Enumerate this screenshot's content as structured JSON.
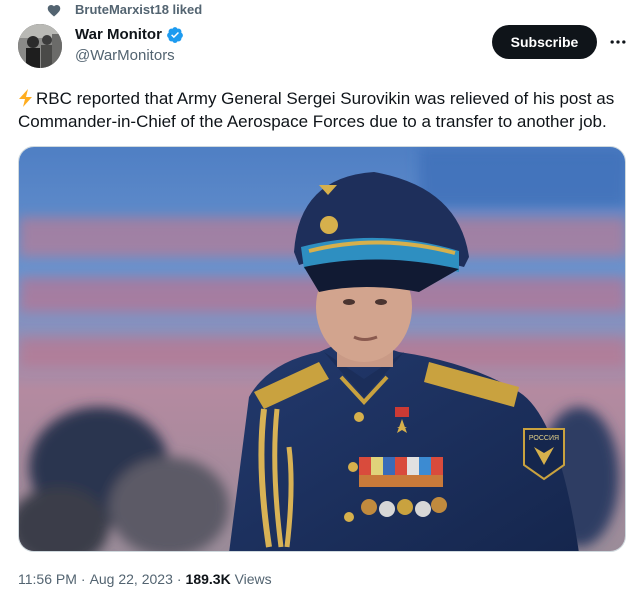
{
  "social_context": {
    "text": "BruteMarxist18 liked",
    "icon": "heart-icon"
  },
  "author": {
    "display_name": "War Monitor",
    "handle": "@WarMonitors",
    "verified_icon": "verified-badge-icon",
    "verified_color": "#1d9bf0"
  },
  "actions": {
    "subscribe_label": "Subscribe",
    "more_icon": "more-dots-icon"
  },
  "tweet": {
    "lead_icon": "lightning-bolt-icon",
    "text": "RBC reported that Army General Sergei Surovikin was relieved of his post as Commander-in-Chief of the Aerospace Forces due to a transfer to another job."
  },
  "media": {
    "patch_text": "РОССИЯ"
  },
  "meta": {
    "time": "11:56 PM",
    "date": "Aug 22, 2023",
    "views_count": "189.3K",
    "views_label": "Views"
  },
  "colors": {
    "text": "#0f1419",
    "secondary": "#536471",
    "subscribe_bg": "#0f1419",
    "bolt": "#ffad1f"
  }
}
